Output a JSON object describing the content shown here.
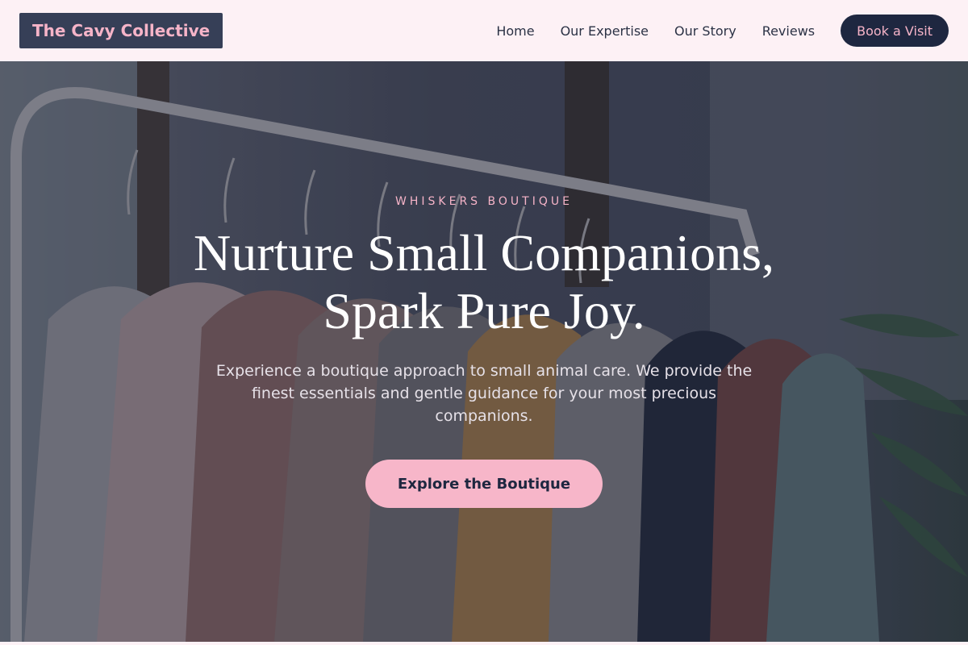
{
  "header": {
    "logo": "The Cavy Collective",
    "nav": [
      {
        "label": "Home"
      },
      {
        "label": "Our Expertise"
      },
      {
        "label": "Our Story"
      },
      {
        "label": "Reviews"
      }
    ],
    "cta_label": "Book a Visit"
  },
  "hero": {
    "eyebrow": "WHISKERS BOUTIQUE",
    "headline_line1": "Nurture Small Companions,",
    "headline_line2": "Spark Pure Joy.",
    "subtext": "Experience a boutique approach to small animal care. We provide the finest essentials and gentle guidance for your most precious companions.",
    "cta_label": "Explore the Boutique",
    "background_image": "clothing-rack-photo"
  },
  "colors": {
    "header_bg": "#fdf1f5",
    "navy": "#1e2740",
    "pink": "#f6b4c8"
  }
}
